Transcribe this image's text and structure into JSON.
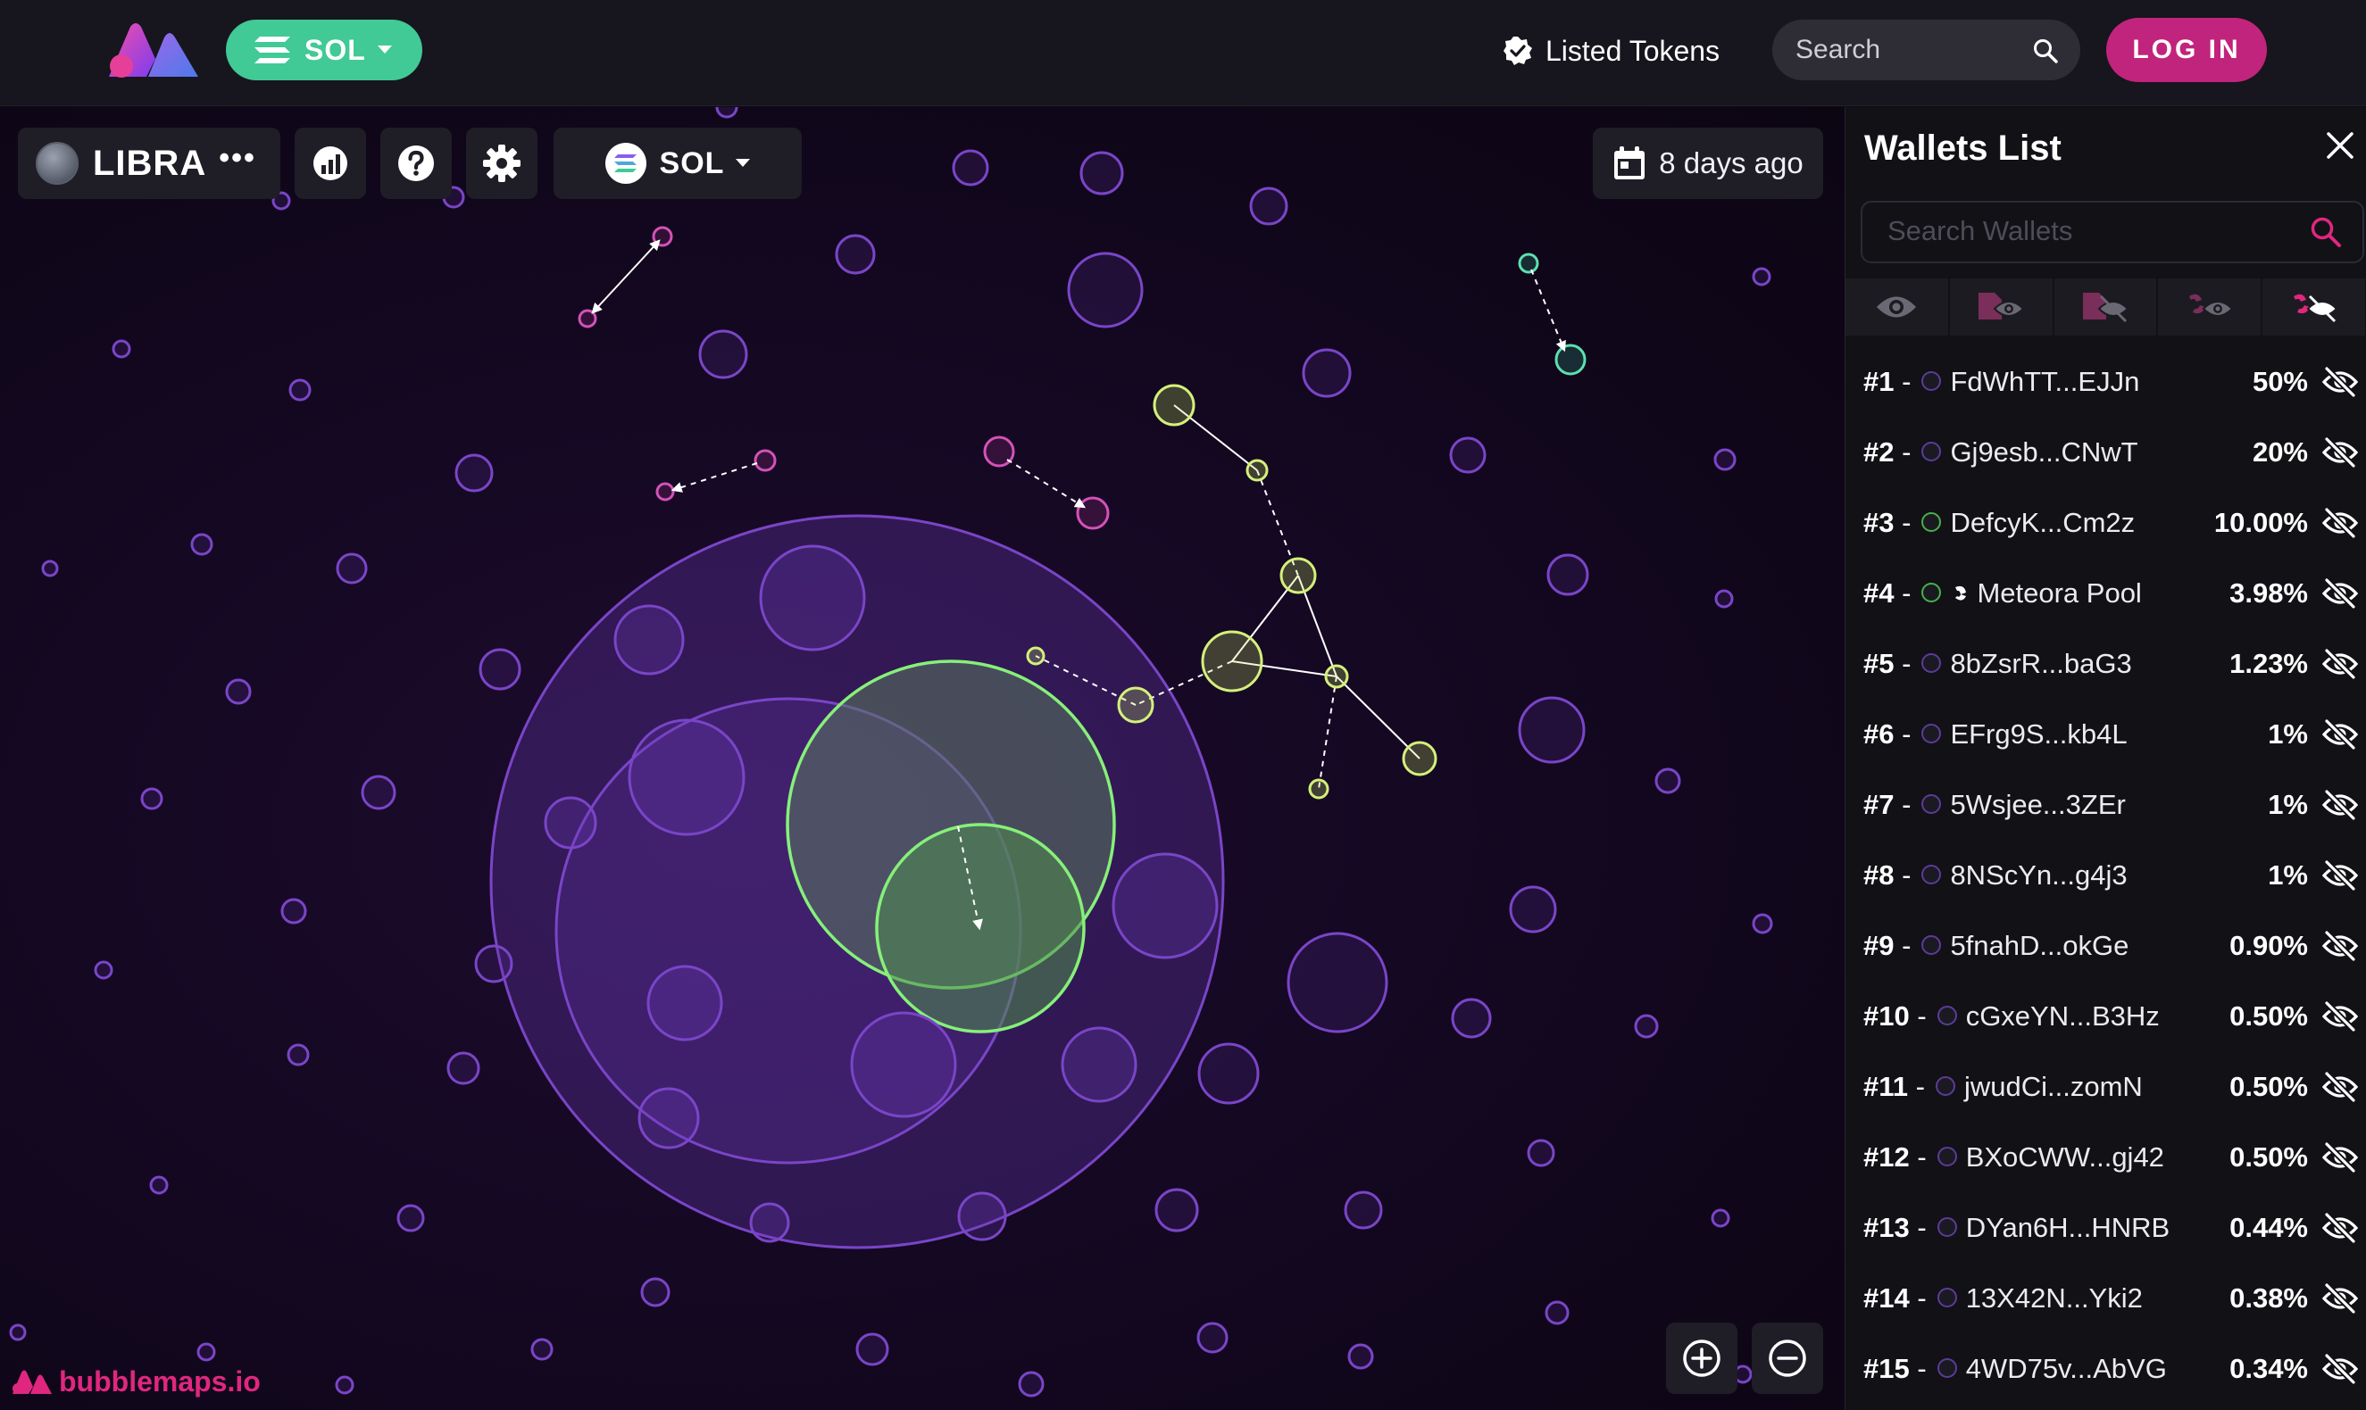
{
  "header": {
    "chain_label": "SOL",
    "listed_tokens_label": "Listed Tokens",
    "search_placeholder": "Search",
    "login_label": "LOG IN"
  },
  "toolbar": {
    "token_name": "LIBRA",
    "token_more": "•••",
    "network_label": "SOL",
    "date_label": "8 days ago"
  },
  "brand": {
    "text": "bubblemaps.io"
  },
  "wallets": {
    "title": "Wallets List",
    "search_placeholder": "Search Wallets",
    "items": [
      {
        "rank": "#1",
        "name": "FdWhTT...EJJn",
        "pct": "50%",
        "color": "#3e2a6b"
      },
      {
        "rank": "#2",
        "name": "Gj9esb...CNwT",
        "pct": "20%",
        "color": "#3e2a6b"
      },
      {
        "rank": "#3",
        "name": "DefcyK...Cm2z",
        "pct": "10.00%",
        "color": "#3a7a3e"
      },
      {
        "rank": "#4",
        "name": "Meteora Pool",
        "pct": "3.98%",
        "color": "#3a7a3e"
      },
      {
        "rank": "#5",
        "name": "8bZsrR...baG3",
        "pct": "1.23%",
        "color": "#3e2a6b"
      },
      {
        "rank": "#6",
        "name": "EFrg9S...kb4L",
        "pct": "1%",
        "color": "#3e2a6b"
      },
      {
        "rank": "#7",
        "name": "5Wsjee...3ZEr",
        "pct": "1%",
        "color": "#3e2a6b"
      },
      {
        "rank": "#8",
        "name": "8NScYn...g4j3",
        "pct": "1%",
        "color": "#3e2a6b"
      },
      {
        "rank": "#9",
        "name": "5fnahD...okGe",
        "pct": "0.90%",
        "color": "#3e2a6b"
      },
      {
        "rank": "#10",
        "name": "cGxeYN...B3Hz",
        "pct": "0.50%",
        "color": "#3e2a6b"
      },
      {
        "rank": "#11",
        "name": "jwudCi...zomN",
        "pct": "0.50%",
        "color": "#3e2a6b"
      },
      {
        "rank": "#12",
        "name": "BXoCWW...gj42",
        "pct": "0.50%",
        "color": "#3e2a6b"
      },
      {
        "rank": "#13",
        "name": "DYan6H...HNRB",
        "pct": "0.44%",
        "color": "#3e2a6b"
      },
      {
        "rank": "#14",
        "name": "13X42N...Yki2",
        "pct": "0.38%",
        "color": "#3e2a6b"
      },
      {
        "rank": "#15",
        "name": "4WD75v...AbVG",
        "pct": "0.34%",
        "color": "#3e2a6b"
      }
    ]
  },
  "colors": {
    "accent_pink": "#c1247c",
    "brand_pink": "#e0277f",
    "sol_green": "#41c996",
    "bubble_purple": "#7a45c8",
    "bubble_green": "#86f07a",
    "bubble_lime": "#d4f07a"
  },
  "icons": {
    "logo": "bubblemaps-logo",
    "listed": "verified-badge-icon",
    "search": "search-icon",
    "calendar": "calendar-icon",
    "close": "close-icon",
    "eye": "eye-icon",
    "eye_off": "eye-off-icon",
    "zoom_in": "zoom-in-icon",
    "zoom_out": "zoom-out-icon"
  }
}
